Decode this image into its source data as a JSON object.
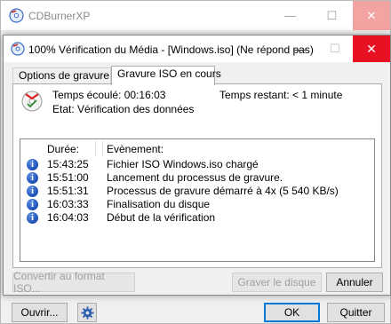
{
  "main_window": {
    "title": "CDBurnerXP",
    "buttons": {
      "open": "Ouvrir...",
      "ok": "OK",
      "quit": "Quitter"
    }
  },
  "dialog": {
    "title": "100% Vérification du Média - [Windows.iso] (Ne répond pas)",
    "tabs": [
      {
        "label": "Options de gravure ISO",
        "active": false
      },
      {
        "label": "Gravure ISO en cours",
        "active": true
      }
    ],
    "status": {
      "elapsed": "Temps écoulé: 00:16:03",
      "remaining": "Temps restant: < 1 minute",
      "state": "Etat: Vérification des données"
    },
    "log": {
      "columns": {
        "duration": "Durée:",
        "event": "Evènement:"
      },
      "rows": [
        {
          "time": "15:43:25",
          "event": "Fichier ISO Windows.iso chargé"
        },
        {
          "time": "15:51:00",
          "event": "Lancement du processus de gravure."
        },
        {
          "time": "15:51:31",
          "event": "Processus de gravure démarré à 4x (5 540 KB/s)"
        },
        {
          "time": "16:03:33",
          "event": "Finalisation du disque"
        },
        {
          "time": "16:04:03",
          "event": "Début de la vérification"
        }
      ]
    },
    "buttons": {
      "convert": "Convertir au format ISO...",
      "burn": "Graver le disque",
      "cancel": "Annuler"
    }
  },
  "colors": {
    "close_red": "#e81123",
    "close_inactive": "#f4a3a3",
    "info_blue": "#1c4fb6",
    "focus_blue": "#0078d7"
  },
  "icons": [
    "cdburnerxp-icon",
    "disc-progress-icon",
    "info-icon",
    "gear-icon"
  ]
}
